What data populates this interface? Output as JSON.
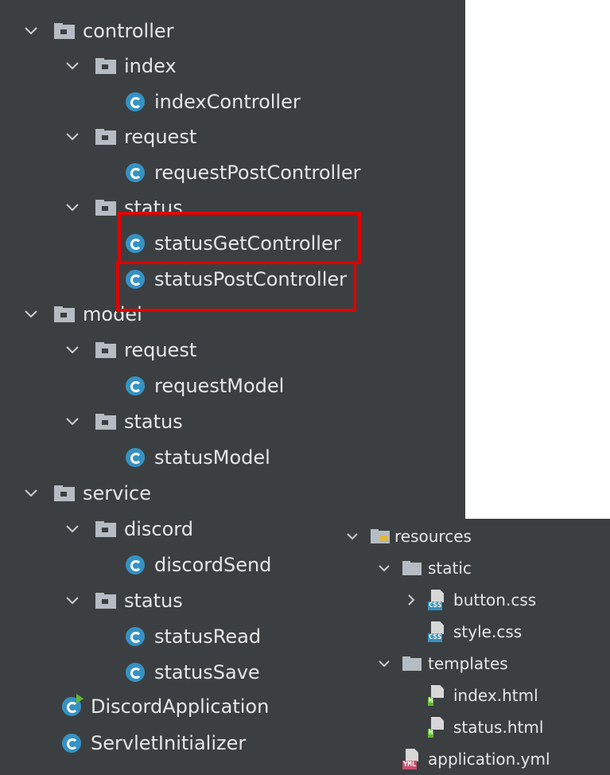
{
  "left_tree": {
    "items": [
      {
        "label": "controller",
        "kind": "folder",
        "expanded": true
      },
      {
        "label": "index",
        "kind": "folder",
        "expanded": true
      },
      {
        "label": "indexController",
        "kind": "class"
      },
      {
        "label": "request",
        "kind": "folder",
        "expanded": true
      },
      {
        "label": "requestPostController",
        "kind": "class"
      },
      {
        "label": "status",
        "kind": "folder",
        "expanded": true
      },
      {
        "label": "statusGetController",
        "kind": "class"
      },
      {
        "label": "statusPostController",
        "kind": "class"
      },
      {
        "label": "model",
        "kind": "folder",
        "expanded": true
      },
      {
        "label": "request",
        "kind": "folder",
        "expanded": true
      },
      {
        "label": "requestModel",
        "kind": "class"
      },
      {
        "label": "status",
        "kind": "folder",
        "expanded": true
      },
      {
        "label": "statusModel",
        "kind": "class"
      },
      {
        "label": "service",
        "kind": "folder",
        "expanded": true
      },
      {
        "label": "discord",
        "kind": "folder",
        "expanded": true
      },
      {
        "label": "discordSend",
        "kind": "class"
      },
      {
        "label": "status",
        "kind": "folder",
        "expanded": true
      },
      {
        "label": "statusRead",
        "kind": "class"
      },
      {
        "label": "statusSave",
        "kind": "class"
      },
      {
        "label": "DiscordApplication",
        "kind": "app-class"
      },
      {
        "label": "ServletInitializer",
        "kind": "class"
      }
    ]
  },
  "right_tree": {
    "items": [
      {
        "label": "resources",
        "kind": "resources-folder",
        "expanded": true
      },
      {
        "label": "static",
        "kind": "folder",
        "expanded": true
      },
      {
        "label": "button.css",
        "kind": "file",
        "tag": "CSS",
        "collapsed_arrow": true
      },
      {
        "label": "style.css",
        "kind": "file",
        "tag": "CSS"
      },
      {
        "label": "templates",
        "kind": "folder",
        "expanded": true
      },
      {
        "label": "index.html",
        "kind": "file",
        "tag": "H"
      },
      {
        "label": "status.html",
        "kind": "file",
        "tag": "H"
      },
      {
        "label": "application.yml",
        "kind": "file",
        "tag": "YML"
      }
    ]
  },
  "colors": {
    "panel_bg": "#3c3f41",
    "text": "#e6e6e6",
    "folder_icon": "#b6bcc3",
    "class_icon": "#3592c4",
    "highlight": "#e00000",
    "css_tag": "#3592c4",
    "html_tag": "#5fb832",
    "yml_tag": "#c94f6d"
  }
}
